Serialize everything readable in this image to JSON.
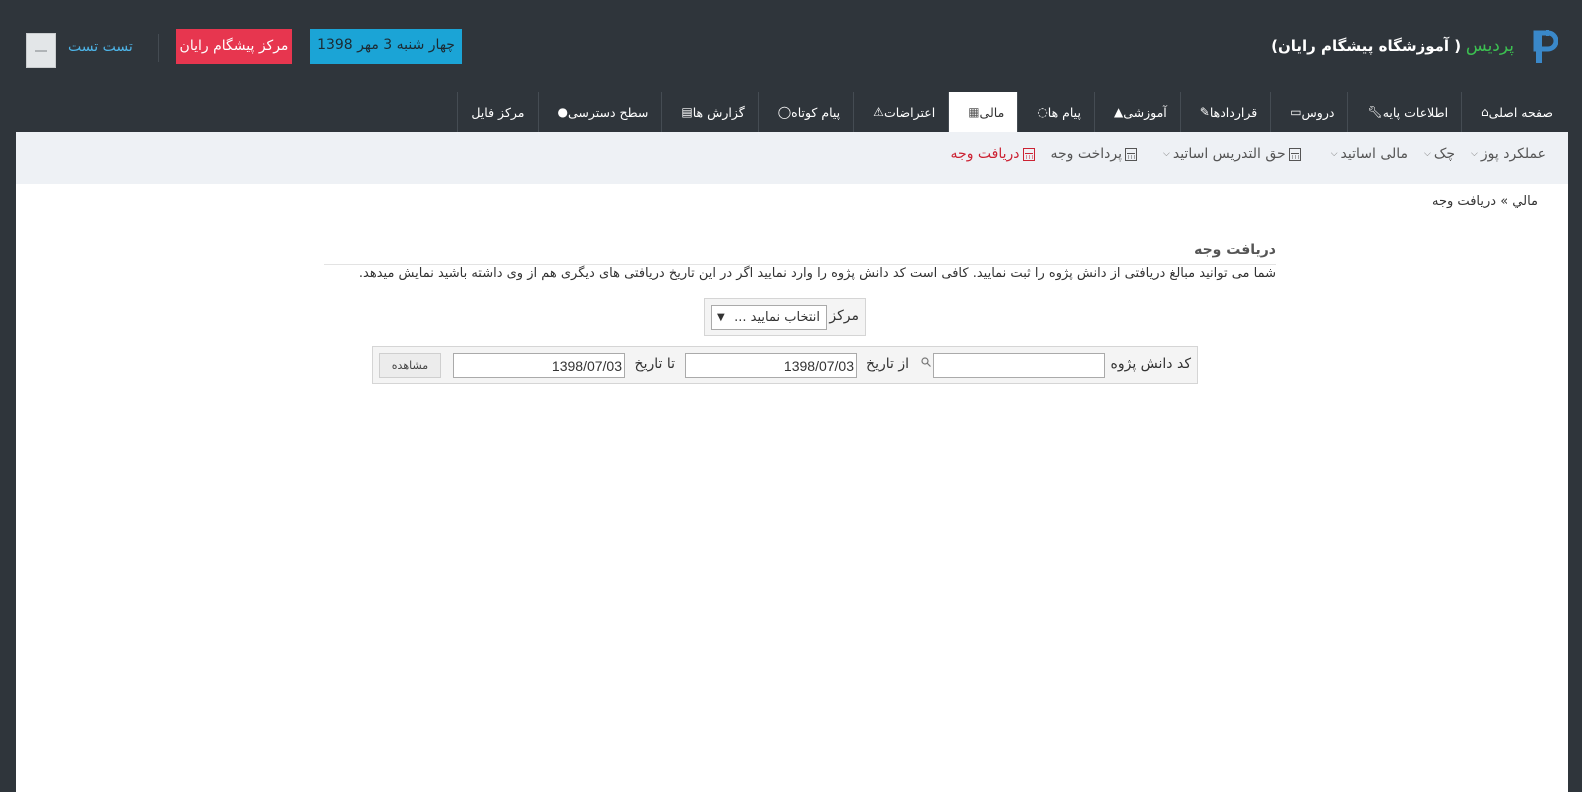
{
  "header": {
    "app_name": "پردیس",
    "institute": "( آموزشگاه پیشگام رایان)",
    "username": "تست تست",
    "center_badge": "مرکز پیشگام رایان",
    "date": "چهار شنبه 3 مهر 1398",
    "colors": {
      "background": "#2f353b",
      "center_badge": "#e7364f",
      "date_badge": "#1ba4d6",
      "brand": "#3cc051"
    }
  },
  "tabs": [
    {
      "label": "صفحه اصلی",
      "icon": "home-icon"
    },
    {
      "label": "اطلاعات پایه",
      "icon": "wrench-icon"
    },
    {
      "label": "دروس",
      "icon": "folder-icon"
    },
    {
      "label": "قراردادها",
      "icon": "edit-icon"
    },
    {
      "label": "آموزشی",
      "icon": "graduation-cap-icon"
    },
    {
      "label": "پیام ها",
      "icon": "comments-icon"
    },
    {
      "label": "مالی",
      "icon": "calculator-icon"
    },
    {
      "label": "اعتراضات",
      "icon": "warning-icon"
    },
    {
      "label": "پیام کوتاه",
      "icon": "comment-icon"
    },
    {
      "label": "گزارش ها",
      "icon": "file-icon"
    },
    {
      "label": "سطح دسترسی",
      "icon": "arrow-circle-icon"
    },
    {
      "label": "مرکز فایل",
      "icon": ""
    }
  ],
  "subnav": {
    "receive": "دریافت وجه",
    "pay": "پرداخت وجه",
    "teaching_fee": "حق التدریس اساتید",
    "teachers_finance": "مالی اساتید",
    "check": "چک",
    "pos": "عملکرد پوز"
  },
  "breadcrumb": "مالي » دریافت وجه",
  "form": {
    "title": "دریافت وجه",
    "description": "شما می توانید مبالغ دریافتی از دانش پژوه را ثبت نمایید. کافی است کد دانش پژوه را وارد نمایید اگر در این تاریخ دریافتی های دیگری هم از وی داشته باشید نمایش میدهد.",
    "center_label": "مرکز",
    "center_select": "انتخاب نمایید ...",
    "student_code_label": "کد دانش پژوه",
    "student_code_value": "",
    "from_date_label": "از تاریخ",
    "from_date_value": "1398/07/03",
    "to_date_label": "تا تاریخ",
    "to_date_value": "1398/07/03",
    "view_button": "مشاهده"
  }
}
